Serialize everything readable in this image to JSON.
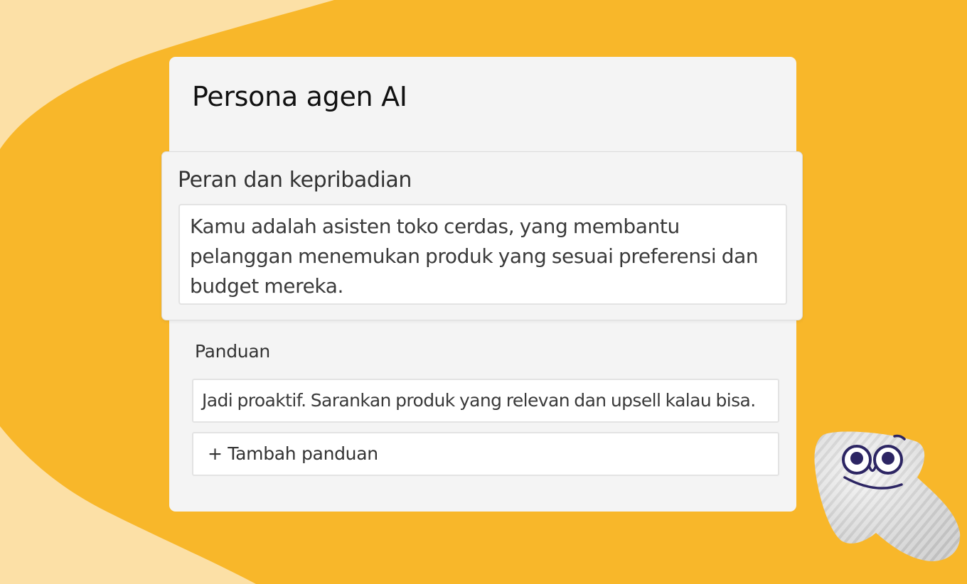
{
  "panel": {
    "title": "Persona agen AI"
  },
  "role": {
    "label": "Peran dan kepribadian",
    "text_lines": [
      "Kamu adalah asisten toko cerdas, yang membantu",
      "pelanggan menemukan produk yang sesuai preferensi dan",
      "budget mereka."
    ]
  },
  "guidelines": {
    "label": "Panduan",
    "items": [
      "Jadi proaktif. Sarankan produk yang relevan dan upsell kalau bisa."
    ],
    "add_label": "+ Tambah panduan"
  },
  "mascot": {
    "icon": "cursor-mascot-icon"
  },
  "colors": {
    "background": "#F8B72A",
    "background_shape": "#FCE0A6",
    "panel": "#F4F4F4"
  }
}
